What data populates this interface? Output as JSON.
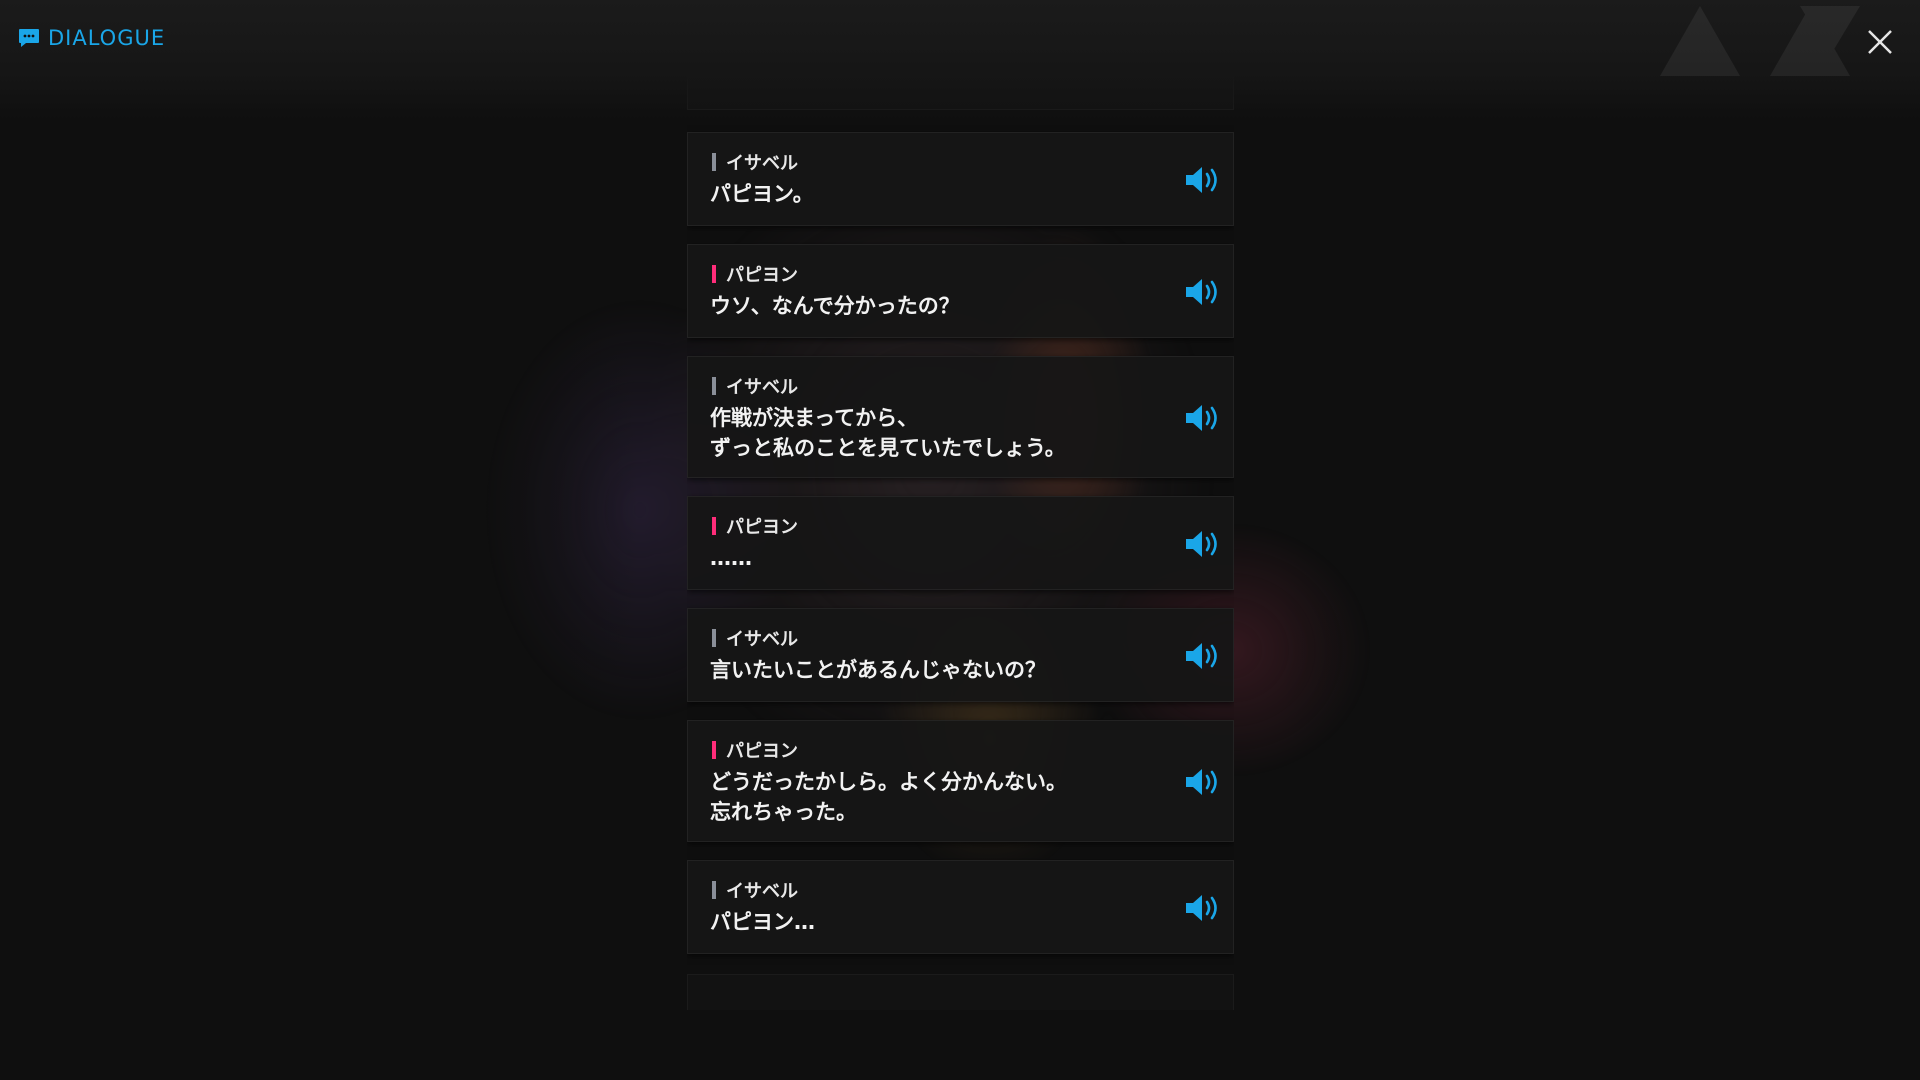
{
  "header": {
    "title": "DIALOGUE",
    "accent_color": "#1aa6e8",
    "close_icon": "close-icon"
  },
  "speaker_colors": {
    "イサベル": "#8a8f99",
    "パピヨン": "#ff2d7a"
  },
  "dialogue": [
    {
      "speaker": "イサベル",
      "lines": [
        "パピヨン。"
      ]
    },
    {
      "speaker": "パピヨン",
      "lines": [
        "ウソ、なんで分かったの？"
      ]
    },
    {
      "speaker": "イサベル",
      "lines": [
        "作戦が決まってから、",
        "ずっと私のことを見ていたでしょう。"
      ]
    },
    {
      "speaker": "パピヨン",
      "lines": [
        "……"
      ]
    },
    {
      "speaker": "イサベル",
      "lines": [
        "言いたいことがあるんじゃないの？"
      ]
    },
    {
      "speaker": "パピヨン",
      "lines": [
        "どうだったかしら。よく分かんない。",
        "忘れちゃった。"
      ]
    },
    {
      "speaker": "イサベル",
      "lines": [
        "パピヨン…"
      ]
    }
  ]
}
